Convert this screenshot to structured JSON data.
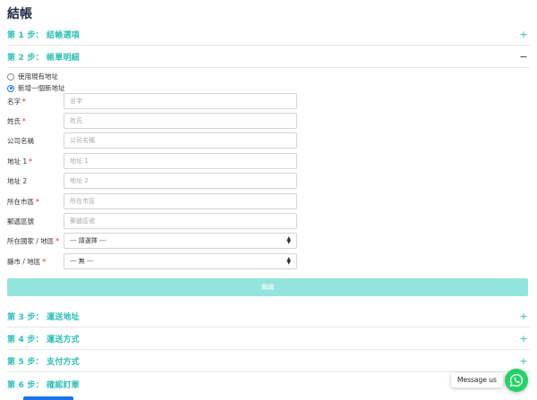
{
  "page": {
    "title": "結帳"
  },
  "steps": [
    {
      "label": "第 1 步： 結帳選項",
      "toggle": "+"
    },
    {
      "label": "第 2 步： 帳單明細",
      "toggle": "−"
    },
    {
      "label": "第 3 步： 運送地址",
      "toggle": "+"
    },
    {
      "label": "第 4 步： 運送方式",
      "toggle": "+"
    },
    {
      "label": "第 5 步： 支付方式",
      "toggle": "+"
    },
    {
      "label": "第 6 步： 確認訂單",
      "toggle": "+"
    }
  ],
  "address_choice": {
    "existing": "使用現有地址",
    "new": "新增一個新地址",
    "selected": "new"
  },
  "form": {
    "first_name": {
      "label": "名字",
      "placeholder": "名字",
      "required": "*"
    },
    "last_name": {
      "label": "姓氏",
      "placeholder": "姓氏",
      "required": "*"
    },
    "company": {
      "label": "公司名稱",
      "placeholder": "公司名稱"
    },
    "address1": {
      "label": "地址 1",
      "placeholder": "地址 1",
      "required": "*"
    },
    "address2": {
      "label": "地址 2",
      "placeholder": "地址 2"
    },
    "city": {
      "label": "所在市區",
      "placeholder": "所在市區",
      "required": "*"
    },
    "postcode": {
      "label": "郵遞區號",
      "placeholder": "郵遞區號"
    },
    "country": {
      "label": "所在國家 / 地區",
      "value": "--- 請選擇 ---",
      "required": "*"
    },
    "zone": {
      "label": "縣市 / 地區",
      "value": "--- 無 ---",
      "required": "*"
    }
  },
  "continue_button": {
    "label": "繼續"
  },
  "chat": {
    "label": "Message us",
    "icon": "whatsapp-icon"
  },
  "colors": {
    "accent": "#2bbfb7",
    "button": "#93e4dd",
    "required": "#e02020",
    "whatsapp": "#25d366"
  }
}
